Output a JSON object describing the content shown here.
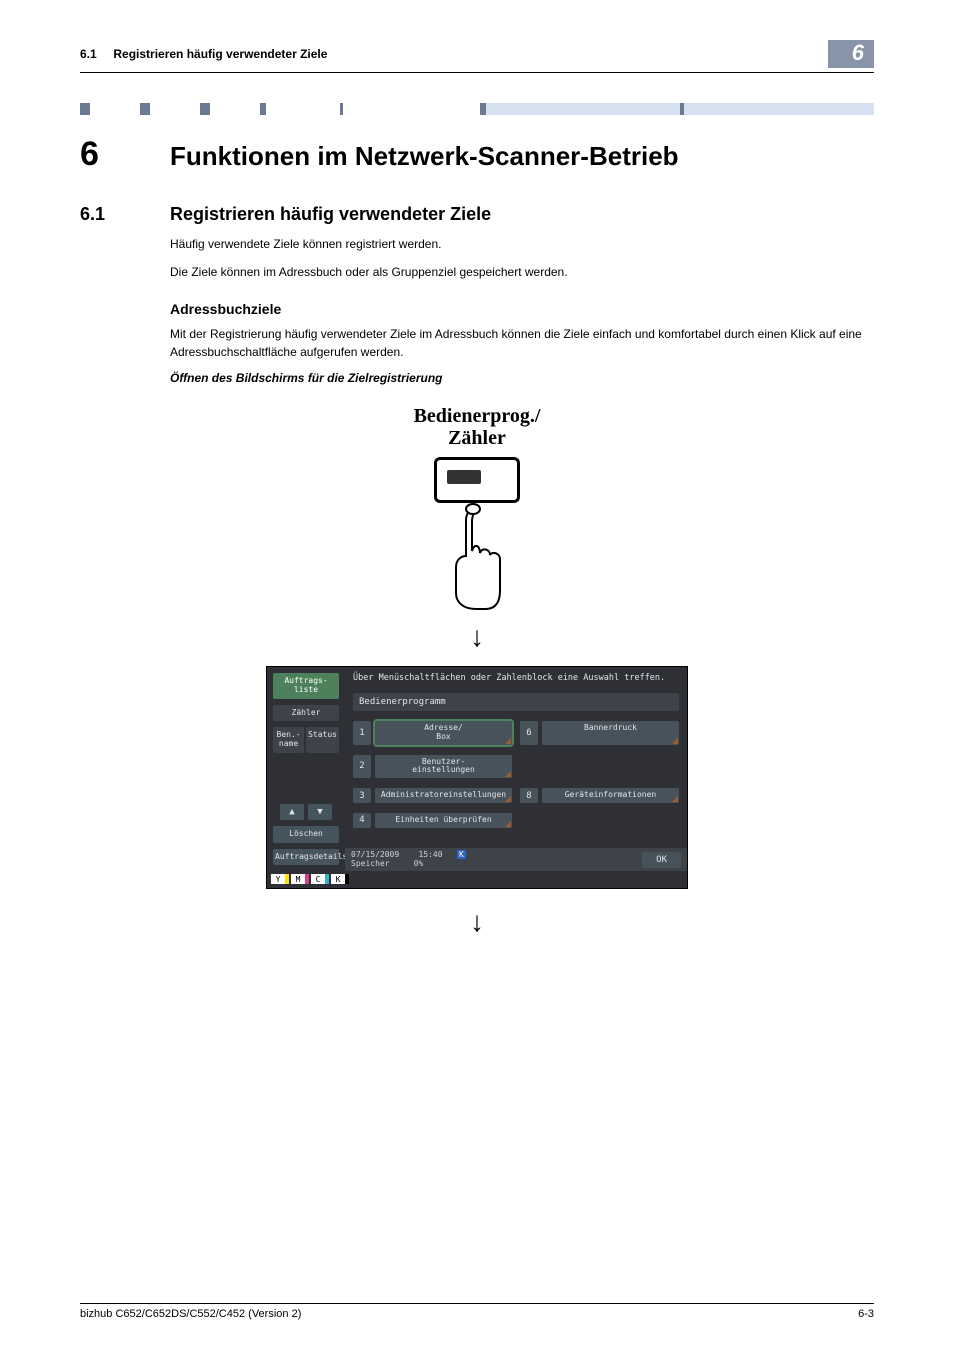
{
  "running_header": {
    "section_num": "6.1",
    "section_title": "Registrieren häufig verwendeter Ziele",
    "chapter_badge": "6"
  },
  "chapter": {
    "num": "6",
    "title": "Funktionen im Netzwerk-Scanner-Betrieb"
  },
  "section": {
    "num": "6.1",
    "title": "Registrieren häufig verwendeter Ziele"
  },
  "para1": "Häufig verwendete Ziele können registriert werden.",
  "para2": "Die Ziele können im Adressbuch oder als Gruppenziel gespeichert werden.",
  "subhead": "Adressbuchziele",
  "para3": "Mit der Registrierung häufig verwendeter Ziele im Adressbuch können die Ziele einfach und komfortabel durch einen Klick auf eine Adressbuchschaltfläche aufgerufen werden.",
  "stephead": "Öffnen des Bildschirms für die Zielregistrierung",
  "key_label_line1": "Bedienerprog./",
  "key_label_line2": "Zähler",
  "mfp": {
    "left": {
      "jobs": "Auftrags-\nliste",
      "counter": "Zähler",
      "user": "Ben.-\nname",
      "status": "Status",
      "delete": "Löschen",
      "details": "Auftragsdetails"
    },
    "instruction": "Über Menüschaltflächen oder Zahlenblock eine Auswahl treffen.",
    "program": "Bedienerprogramm",
    "menu": [
      {
        "num": "1",
        "label": "Adresse/\nBox",
        "corner": true,
        "selected": true
      },
      {
        "num": "6",
        "label": "Bannerdruck",
        "corner": true
      },
      {
        "num": "2",
        "label": "Benutzer-\neinstellungen",
        "corner": true
      },
      {
        "num": "",
        "label": "",
        "empty": true
      },
      {
        "num": "3",
        "label": "Administratoreinstellungen",
        "corner": true
      },
      {
        "num": "8",
        "label": "Geräteinformationen",
        "corner": true
      },
      {
        "num": "4",
        "label": "Einheiten überprüfen",
        "corner": true
      },
      {
        "num": "",
        "label": "",
        "empty": true
      }
    ],
    "date": "07/15/2009",
    "time": "15:40",
    "memory_label": "Speicher",
    "memory_val": "0%",
    "ok": "OK",
    "ink": {
      "y": "Y",
      "m": "M",
      "c": "C",
      "k": "K"
    }
  },
  "footer": {
    "left": "bizhub C652/C652DS/C552/C452 (Version 2)",
    "right": "6-3"
  }
}
